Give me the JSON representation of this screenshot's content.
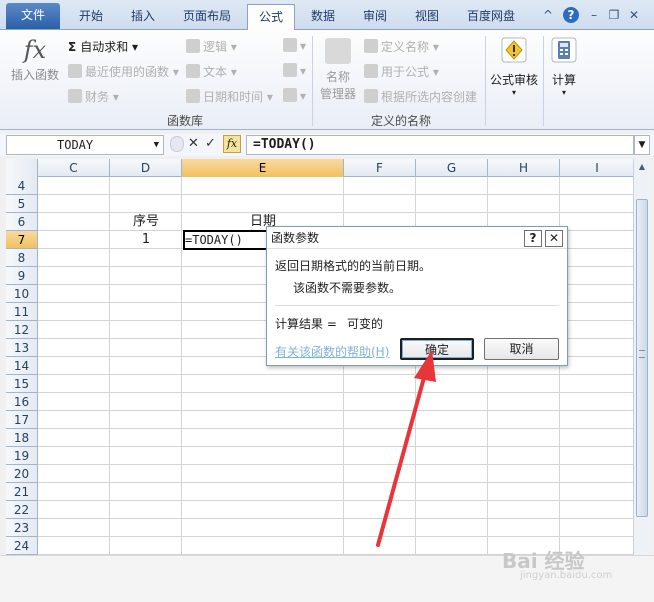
{
  "tabs": [
    {
      "label": "文件"
    },
    {
      "label": "开始"
    },
    {
      "label": "插入"
    },
    {
      "label": "页面布局"
    },
    {
      "label": "公式"
    },
    {
      "label": "数据"
    },
    {
      "label": "审阅"
    },
    {
      "label": "视图"
    },
    {
      "label": "百度网盘"
    }
  ],
  "window_controls": {
    "minimize_ribbon": "^",
    "help": "?",
    "minimize": "–",
    "restore": "❐",
    "close": "✕"
  },
  "ribbon": {
    "insert_function": {
      "icon_text": "fx",
      "label": "插入函数"
    },
    "function_library": {
      "autosum": "自动求和",
      "recent": "最近使用的函数",
      "financial": "财务",
      "logical": "逻辑",
      "text": "文本",
      "datetime": "日期和时间",
      "group_label": "函数库"
    },
    "defined_names": {
      "name_manager_line1": "名称",
      "name_manager_line2": "管理器",
      "define_name": "定义名称",
      "use_in_formula": "用于公式",
      "create_from_selection": "根据所选内容创建",
      "group_label": "定义的名称"
    },
    "formula_auditing": {
      "label": "公式审核"
    },
    "calculation": {
      "label": "计算"
    }
  },
  "formula_bar": {
    "name_box": "TODAY",
    "formula": "=TODAY()",
    "fx_label": "fx",
    "cancel": "✕",
    "enter": "✓"
  },
  "grid": {
    "columns": [
      "C",
      "D",
      "E",
      "F",
      "G",
      "H",
      "I"
    ],
    "selected_column": "E",
    "rows": [
      "4",
      "5",
      "6",
      "7",
      "8",
      "9",
      "10",
      "11",
      "12",
      "13",
      "14",
      "15",
      "16",
      "17",
      "18",
      "19",
      "20",
      "21",
      "22",
      "23",
      "24"
    ],
    "selected_row": "7",
    "cells": {
      "D6": "序号",
      "E6": "日期",
      "D7": "1",
      "E7": "=TODAY()"
    }
  },
  "dialog": {
    "title": "函数参数",
    "help_btn": "?",
    "close_btn": "✕",
    "description": "返回日期格式的的当前日期。",
    "no_args": "该函数不需要参数。",
    "result_label": "计算结果 =",
    "result_value": "可变的",
    "help_link": "有关该函数的帮助(H)",
    "ok": "确定",
    "cancel": "取消"
  },
  "watermark": {
    "text": "Bai 经验",
    "url": "jingyan.baidu.com"
  },
  "colors": {
    "accent_arrow": "#e8353a",
    "selected_header": "#f6c86a",
    "file_tab": "#2a5fa8"
  }
}
